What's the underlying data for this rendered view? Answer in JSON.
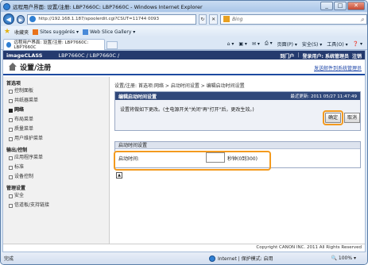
{
  "window": {
    "title": "远程用户界面: 设置/注册: LBP7660C: LBP7660C - Windows Internet Explorer"
  },
  "browser": {
    "url": "http://192.168.1.187/spoolerdit.cgi?CSUT=11744 0093",
    "search_placeholder": "Bing",
    "favorites_label": "收藏夹",
    "fav_items": [
      "Sites suggérés ▾",
      "Web Slice Gallery ▾"
    ],
    "tab_title": "远程用户界面: 设置/注册: LBP7660C: LBP7660C",
    "commands": [
      "页面(P) ▾",
      "安全(S) ▾",
      "工具(O) ▾",
      "❓ ▾"
    ]
  },
  "app": {
    "brand": "imageCLASS",
    "model": "LBP7660C / LBP7660C /",
    "top_links": [
      "到门户",
      "登录用户: 系统管理员",
      "注销"
    ],
    "page_title": "设置/注册",
    "mail_link": "发送邮件到系统管理员"
  },
  "sidebar": {
    "sections": [
      {
        "title": "首选项",
        "items": [
          "控制面板",
          "共纸器菜单",
          "网络",
          "布局菜单",
          "质量菜单",
          "用户维护菜单"
        ],
        "active": 2
      },
      {
        "title": "输出/控制",
        "items": [
          "应用程序菜单",
          "标准",
          "设备控制"
        ]
      },
      {
        "title": "管理设置",
        "items": [
          "安全",
          "信道板/支持链接"
        ]
      }
    ]
  },
  "main": {
    "breadcrumb": "设置/注册: 首选项:网络 > 启动时间设置 > 编辑启动时间设置",
    "panel_title": "编辑启动时间设置",
    "last_update": "最近更新: 2011 05/27 11:47:49",
    "instruction": "设置将做如下更改。(主电源开关\"关闭\"再\"打开\"后，更改生效。)",
    "ok_label": "确定",
    "cancel_label": "取消",
    "section_title": "启动时间设置",
    "field_label": "启动时间:",
    "field_value": "",
    "field_unit": "秒钟(0到300)"
  },
  "footer": {
    "copyright": "Copyright CANON INC. 2011 All Rights Reserved"
  },
  "status": {
    "left": "完成",
    "zone": "Internet | 保护模式: 启用",
    "zoom": "🔍 100% ▾"
  }
}
